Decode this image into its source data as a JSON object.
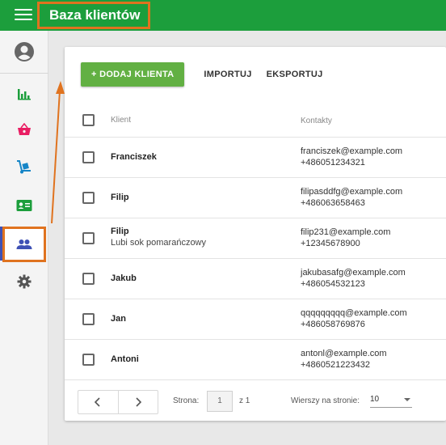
{
  "app": {
    "title": "Baza klientów"
  },
  "sidebar": {
    "items": [
      {
        "name": "account-icon"
      },
      {
        "name": "bar-chart-icon"
      },
      {
        "name": "basket-icon"
      },
      {
        "name": "hand-truck-icon"
      },
      {
        "name": "contact-card-icon"
      },
      {
        "name": "people-icon",
        "active": true
      },
      {
        "name": "gear-icon"
      }
    ]
  },
  "toolbar": {
    "add_label": "+ DODAJ KLIENTA",
    "import_label": "IMPORTUJ",
    "export_label": "EKSPORTUJ"
  },
  "table": {
    "headers": {
      "client": "Klient",
      "contacts": "Kontakty"
    },
    "rows": [
      {
        "name": "Franciszek",
        "note": "",
        "email": "franciszek@example.com",
        "phone": "+486051234321"
      },
      {
        "name": "Filip",
        "note": "",
        "email": "filipasddfg@example.com",
        "phone": "+486063658463"
      },
      {
        "name": "Filip",
        "note": "Lubi sok pomarańczowy",
        "email": "filip231@example.com",
        "phone": "+12345678900"
      },
      {
        "name": "Jakub",
        "note": "",
        "email": "jakubasafg@example.com",
        "phone": "+486054532123"
      },
      {
        "name": "Jan",
        "note": "",
        "email": "qqqqqqqqq@example.com",
        "phone": "+486058769876"
      },
      {
        "name": "Antoni",
        "note": "",
        "email": "antonl@example.com",
        "phone": "+4860521223432"
      }
    ]
  },
  "pager": {
    "prev_icon": "chevron-left-icon",
    "next_icon": "chevron-right-icon",
    "page_label": "Strona:",
    "page_value": "1",
    "of_label": "z 1",
    "rows_per_page_label": "Wierszy na stronie:",
    "rows_per_page_value": "10"
  },
  "colors": {
    "topbar": "#1c9e3c",
    "add_button": "#62b043",
    "highlight": "#e0731f"
  }
}
